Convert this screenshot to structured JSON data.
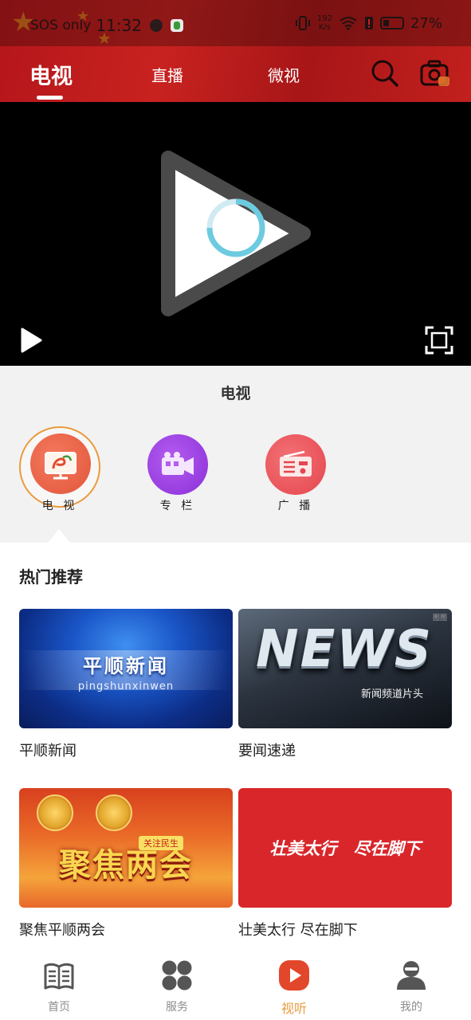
{
  "status_bar": {
    "carrier": "SOS only",
    "time": "11:32",
    "speed_value": "192",
    "speed_unit": "K/s",
    "battery": "27%"
  },
  "header": {
    "tabs": [
      {
        "label": "电视",
        "active": true
      },
      {
        "label": "直播",
        "active": false
      },
      {
        "label": "微视",
        "active": false
      }
    ],
    "icons": [
      "search-icon",
      "camera-icon"
    ]
  },
  "player": {
    "icons": [
      "play-icon",
      "loading-spinner-icon",
      "fullscreen-icon"
    ]
  },
  "channel_section": {
    "title": "电视",
    "categories": [
      {
        "label": "电 视",
        "icon": "tv-icon",
        "color": "#e1553a",
        "selected": true
      },
      {
        "label": "专 栏",
        "icon": "video-camera-icon",
        "color": "#8b2fd8",
        "selected": false
      },
      {
        "label": "广 播",
        "icon": "radio-icon",
        "color": "#e5454d",
        "selected": false
      }
    ]
  },
  "recommend": {
    "title": "热门推荐",
    "items": [
      {
        "caption": "平顺新闻",
        "thumb_title": "平顺新闻",
        "thumb_sub": "pingshunxinwen"
      },
      {
        "caption": "要闻速递",
        "thumb_title": "NEWS",
        "thumb_sub": "新闻频道片头",
        "thumb_wm": "图图"
      },
      {
        "caption": "聚焦平顺两会",
        "thumb_title": "聚焦两会",
        "thumb_tag": "关注民生"
      },
      {
        "caption": "壮美太行 尽在脚下",
        "thumb_title": "壮美太行 尽在脚下"
      }
    ]
  },
  "bottom_nav": {
    "items": [
      {
        "label": "首页",
        "icon": "newspaper-icon",
        "active": false
      },
      {
        "label": "服务",
        "icon": "grid-icon",
        "active": false
      },
      {
        "label": "视听",
        "icon": "play-icon",
        "active": true
      },
      {
        "label": "我的",
        "icon": "user-icon",
        "active": false
      }
    ],
    "active_color": "#e99b3e"
  }
}
